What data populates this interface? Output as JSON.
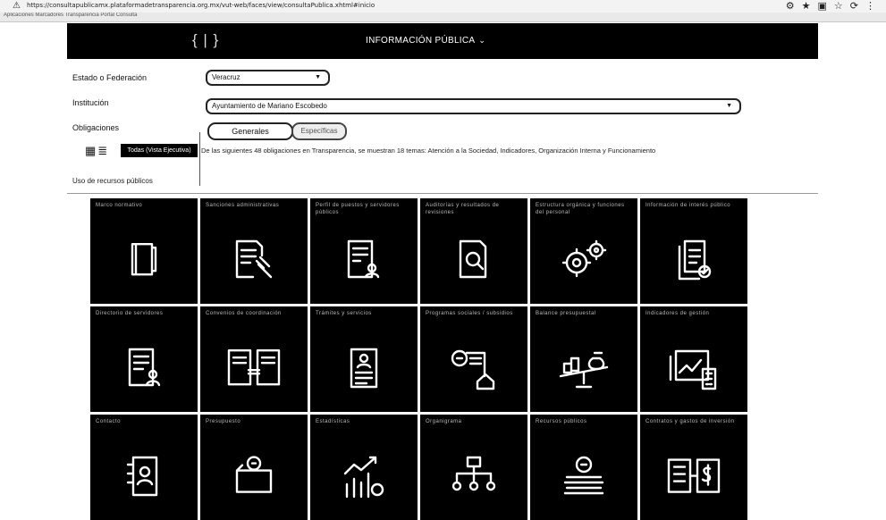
{
  "browser": {
    "url": "https://consultapublicamx.plataformadetransparencia.org.mx/vut-web/faces/view/consultaPublica.xhtml#inicio",
    "bookmarks": "Aplicaciones    Marcadores    Transparencia    Portal    Consulta"
  },
  "nav": {
    "logo": "{ | }",
    "menu_title": "INFORMACIÓN PÚBLICA",
    "chevron": "⌄"
  },
  "filters": {
    "state_label": "Estado o Federación",
    "state_value": "Veracruz",
    "institution_label": "Institución",
    "institution_value": "Ayuntamiento de Mariano Escobedo",
    "obligations_label": "Obligaciones",
    "generate_label": "Generales",
    "specific_label": "Específicas"
  },
  "view": {
    "tag_label": "Todas (Vista Ejecutiva)",
    "hint": "De las siguientes 48 obligaciones en Transparencia, se muestran 18 temas: Atención a la Sociedad, Indicadores, Organización Interna y Funcionamiento",
    "resources_link": "Uso de recursos públicos"
  },
  "tiles": [
    {
      "caption": "Marco normativo",
      "icon": "folder-book-icon"
    },
    {
      "caption": "Sanciones administrativas",
      "icon": "document-gavel-icon"
    },
    {
      "caption": "Perfil de puestos y servidores públicos",
      "icon": "document-person-icon"
    },
    {
      "caption": "Auditorías y resultados de revisiones",
      "icon": "document-search-icon"
    },
    {
      "caption": "Estructura orgánica y funciones del personal",
      "icon": "gears-person-icon"
    },
    {
      "caption": "Información de interés público",
      "icon": "documents-check-icon"
    },
    {
      "caption": "Directorio de servidores",
      "icon": "document-user-icon"
    },
    {
      "caption": "Convenios de coordinación",
      "icon": "documents-exchange-icon"
    },
    {
      "caption": "Trámites y servicios",
      "icon": "document-profile-icon"
    },
    {
      "caption": "Programas sociales / subsidios",
      "icon": "money-house-icon"
    },
    {
      "caption": "Balance presupuestal",
      "icon": "balance-money-icon"
    },
    {
      "caption": "Indicadores de gestión",
      "icon": "chart-calculator-icon"
    },
    {
      "caption": "Contacto",
      "icon": "contact-book-icon"
    },
    {
      "caption": "Presupuesto",
      "icon": "wallet-coin-icon"
    },
    {
      "caption": "Estadísticas",
      "icon": "bar-growth-icon"
    },
    {
      "caption": "Organigrama",
      "icon": "org-chart-icon"
    },
    {
      "caption": "Recursos públicos",
      "icon": "coins-stack-icon"
    },
    {
      "caption": "Contratos y gastos de inversión",
      "icon": "list-money-icon"
    }
  ]
}
